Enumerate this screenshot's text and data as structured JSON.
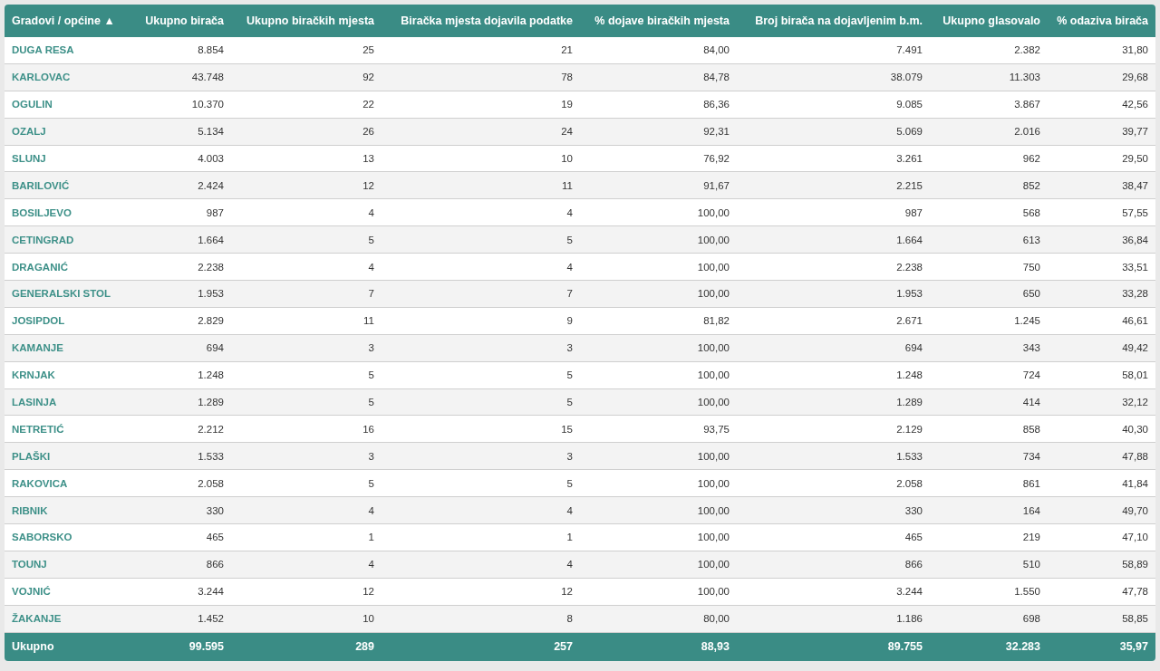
{
  "table": {
    "columns": [
      "Gradovi / općine ▲",
      "Ukupno birača",
      "Ukupno biračkih mjesta",
      "Biračka mjesta dojavila podatke",
      "% dojave biračkih mjesta",
      "Broj birača na dojavljenim b.m.",
      "Ukupno glasovalo",
      "% odaziva birača"
    ],
    "rows": [
      [
        "DUGA RESA",
        "8.854",
        "25",
        "21",
        "84,00",
        "7.491",
        "2.382",
        "31,80"
      ],
      [
        "KARLOVAC",
        "43.748",
        "92",
        "78",
        "84,78",
        "38.079",
        "11.303",
        "29,68"
      ],
      [
        "OGULIN",
        "10.370",
        "22",
        "19",
        "86,36",
        "9.085",
        "3.867",
        "42,56"
      ],
      [
        "OZALJ",
        "5.134",
        "26",
        "24",
        "92,31",
        "5.069",
        "2.016",
        "39,77"
      ],
      [
        "SLUNJ",
        "4.003",
        "13",
        "10",
        "76,92",
        "3.261",
        "962",
        "29,50"
      ],
      [
        "BARILOVIĆ",
        "2.424",
        "12",
        "11",
        "91,67",
        "2.215",
        "852",
        "38,47"
      ],
      [
        "BOSILJEVO",
        "987",
        "4",
        "4",
        "100,00",
        "987",
        "568",
        "57,55"
      ],
      [
        "CETINGRAD",
        "1.664",
        "5",
        "5",
        "100,00",
        "1.664",
        "613",
        "36,84"
      ],
      [
        "DRAGANIĆ",
        "2.238",
        "4",
        "4",
        "100,00",
        "2.238",
        "750",
        "33,51"
      ],
      [
        "GENERALSKI STOL",
        "1.953",
        "7",
        "7",
        "100,00",
        "1.953",
        "650",
        "33,28"
      ],
      [
        "JOSIPDOL",
        "2.829",
        "11",
        "9",
        "81,82",
        "2.671",
        "1.245",
        "46,61"
      ],
      [
        "KAMANJE",
        "694",
        "3",
        "3",
        "100,00",
        "694",
        "343",
        "49,42"
      ],
      [
        "KRNJAK",
        "1.248",
        "5",
        "5",
        "100,00",
        "1.248",
        "724",
        "58,01"
      ],
      [
        "LASINJA",
        "1.289",
        "5",
        "5",
        "100,00",
        "1.289",
        "414",
        "32,12"
      ],
      [
        "NETRETIĆ",
        "2.212",
        "16",
        "15",
        "93,75",
        "2.129",
        "858",
        "40,30"
      ],
      [
        "PLAŠKI",
        "1.533",
        "3",
        "3",
        "100,00",
        "1.533",
        "734",
        "47,88"
      ],
      [
        "RAKOVICA",
        "2.058",
        "5",
        "5",
        "100,00",
        "2.058",
        "861",
        "41,84"
      ],
      [
        "RIBNIK",
        "330",
        "4",
        "4",
        "100,00",
        "330",
        "164",
        "49,70"
      ],
      [
        "SABORSKO",
        "465",
        "1",
        "1",
        "100,00",
        "465",
        "219",
        "47,10"
      ],
      [
        "TOUNJ",
        "866",
        "4",
        "4",
        "100,00",
        "866",
        "510",
        "58,89"
      ],
      [
        "VOJNIĆ",
        "3.244",
        "12",
        "12",
        "100,00",
        "3.244",
        "1.550",
        "47,78"
      ],
      [
        "ŽAKANJE",
        "1.452",
        "10",
        "8",
        "80,00",
        "1.186",
        "698",
        "58,85"
      ]
    ],
    "footer": [
      "Ukupno",
      "99.595",
      "289",
      "257",
      "88,93",
      "89.755",
      "32.283",
      "35,97"
    ]
  }
}
